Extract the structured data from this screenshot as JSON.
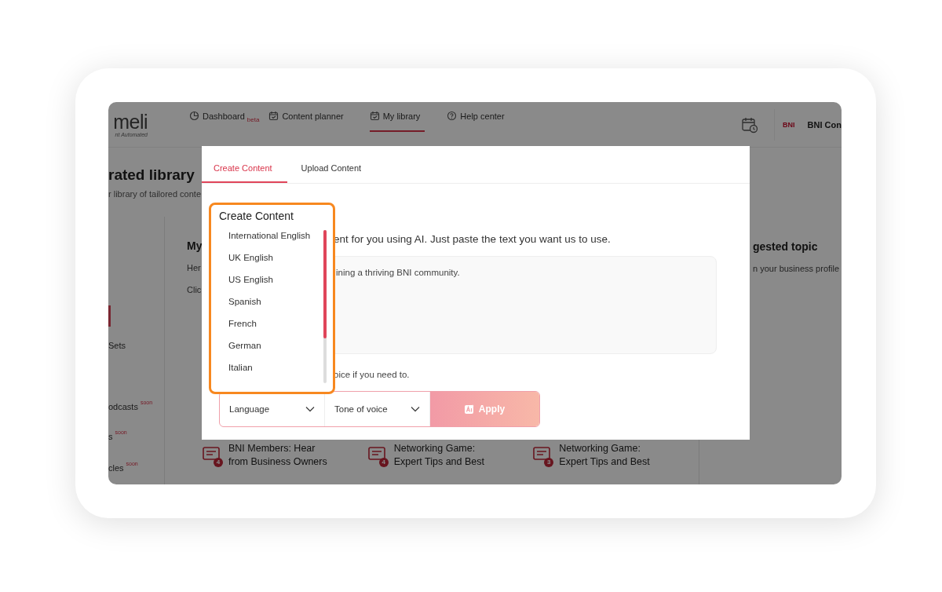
{
  "app": {
    "logo": "meli",
    "tagline": "nt Automated",
    "nav": [
      {
        "label": "Dashboard",
        "badge": "beta",
        "selected": false
      },
      {
        "label": "Content planner",
        "selected": false
      },
      {
        "label": "My library",
        "selected": true
      },
      {
        "label": "Help center",
        "selected": false
      }
    ],
    "account": {
      "logo": "BNI",
      "name": "BNI Con"
    },
    "page_title": "rated library",
    "page_subtitle": "r library of tailored conte",
    "sidebar": [
      {
        "label": "Sets"
      },
      {
        "label": "odcasts",
        "badge": "soon"
      },
      {
        "label": "s",
        "badge": "soon"
      },
      {
        "label": "cles",
        "badge": "soon"
      }
    ],
    "main": {
      "heading": "My",
      "lines": [
        "Her",
        "Clic"
      ],
      "cards": [
        {
          "count": "4",
          "title": "BNI Members: Hear from Business Owners"
        },
        {
          "count": "4",
          "title": "Networking Game: Expert Tips and Best"
        },
        {
          "count": "3",
          "title": "Networking Game: Expert Tips and Best"
        }
      ]
    },
    "suggested": {
      "heading": "gested topic",
      "text": "n your business profile"
    }
  },
  "modal": {
    "tabs": [
      {
        "label": "Create Content",
        "selected": true
      },
      {
        "label": "Upload Content",
        "selected": false
      }
    ],
    "description": "ent for you using AI. Just paste the text you want us to use.",
    "input_value": "ining a thriving BNI community.",
    "hint": "oice if you need to.",
    "selects": [
      {
        "label": "Language"
      },
      {
        "label": "Tone of voice"
      }
    ],
    "apply": {
      "label": "Apply",
      "disabled": true
    }
  },
  "dropdown": {
    "title": "Create Content",
    "options": [
      "International English",
      "UK English",
      "US English",
      "Spanish",
      "French",
      "German",
      "Italian"
    ]
  }
}
